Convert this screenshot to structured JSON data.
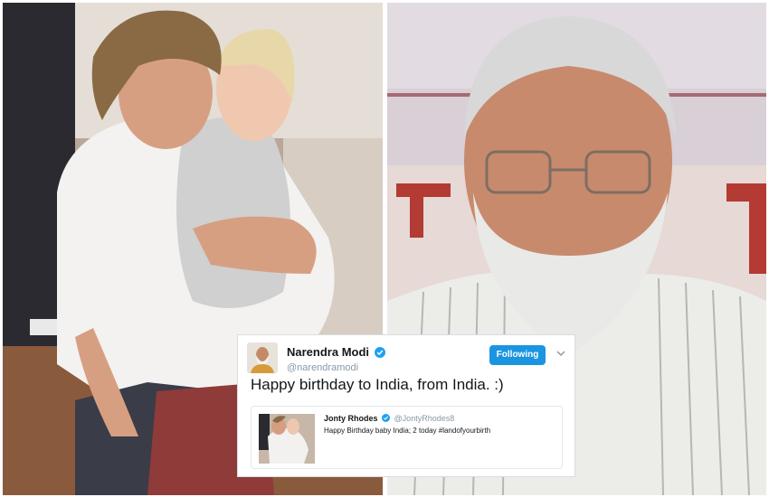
{
  "left_photo": {
    "kind": "photo",
    "subject": "man-holding-child"
  },
  "right_photo": {
    "kind": "photo",
    "subject": "man-with-glasses"
  },
  "tweet": {
    "author_name": "Narendra Modi",
    "author_handle": "@narendramodi",
    "verified": true,
    "follow_label": "Following",
    "text": "Happy birthday to India, from India. :)",
    "quoted": {
      "author_name": "Jonty Rhodes",
      "author_handle": "@JontyRhodes8",
      "verified": true,
      "text": "Happy Birthday baby India; 2 today #landofyourbirth"
    }
  },
  "colors": {
    "follow_button": "#1b95e0",
    "verified_badge": "#1da1f2",
    "handle_text": "#8899a6",
    "card_border": "#d8dde2"
  }
}
